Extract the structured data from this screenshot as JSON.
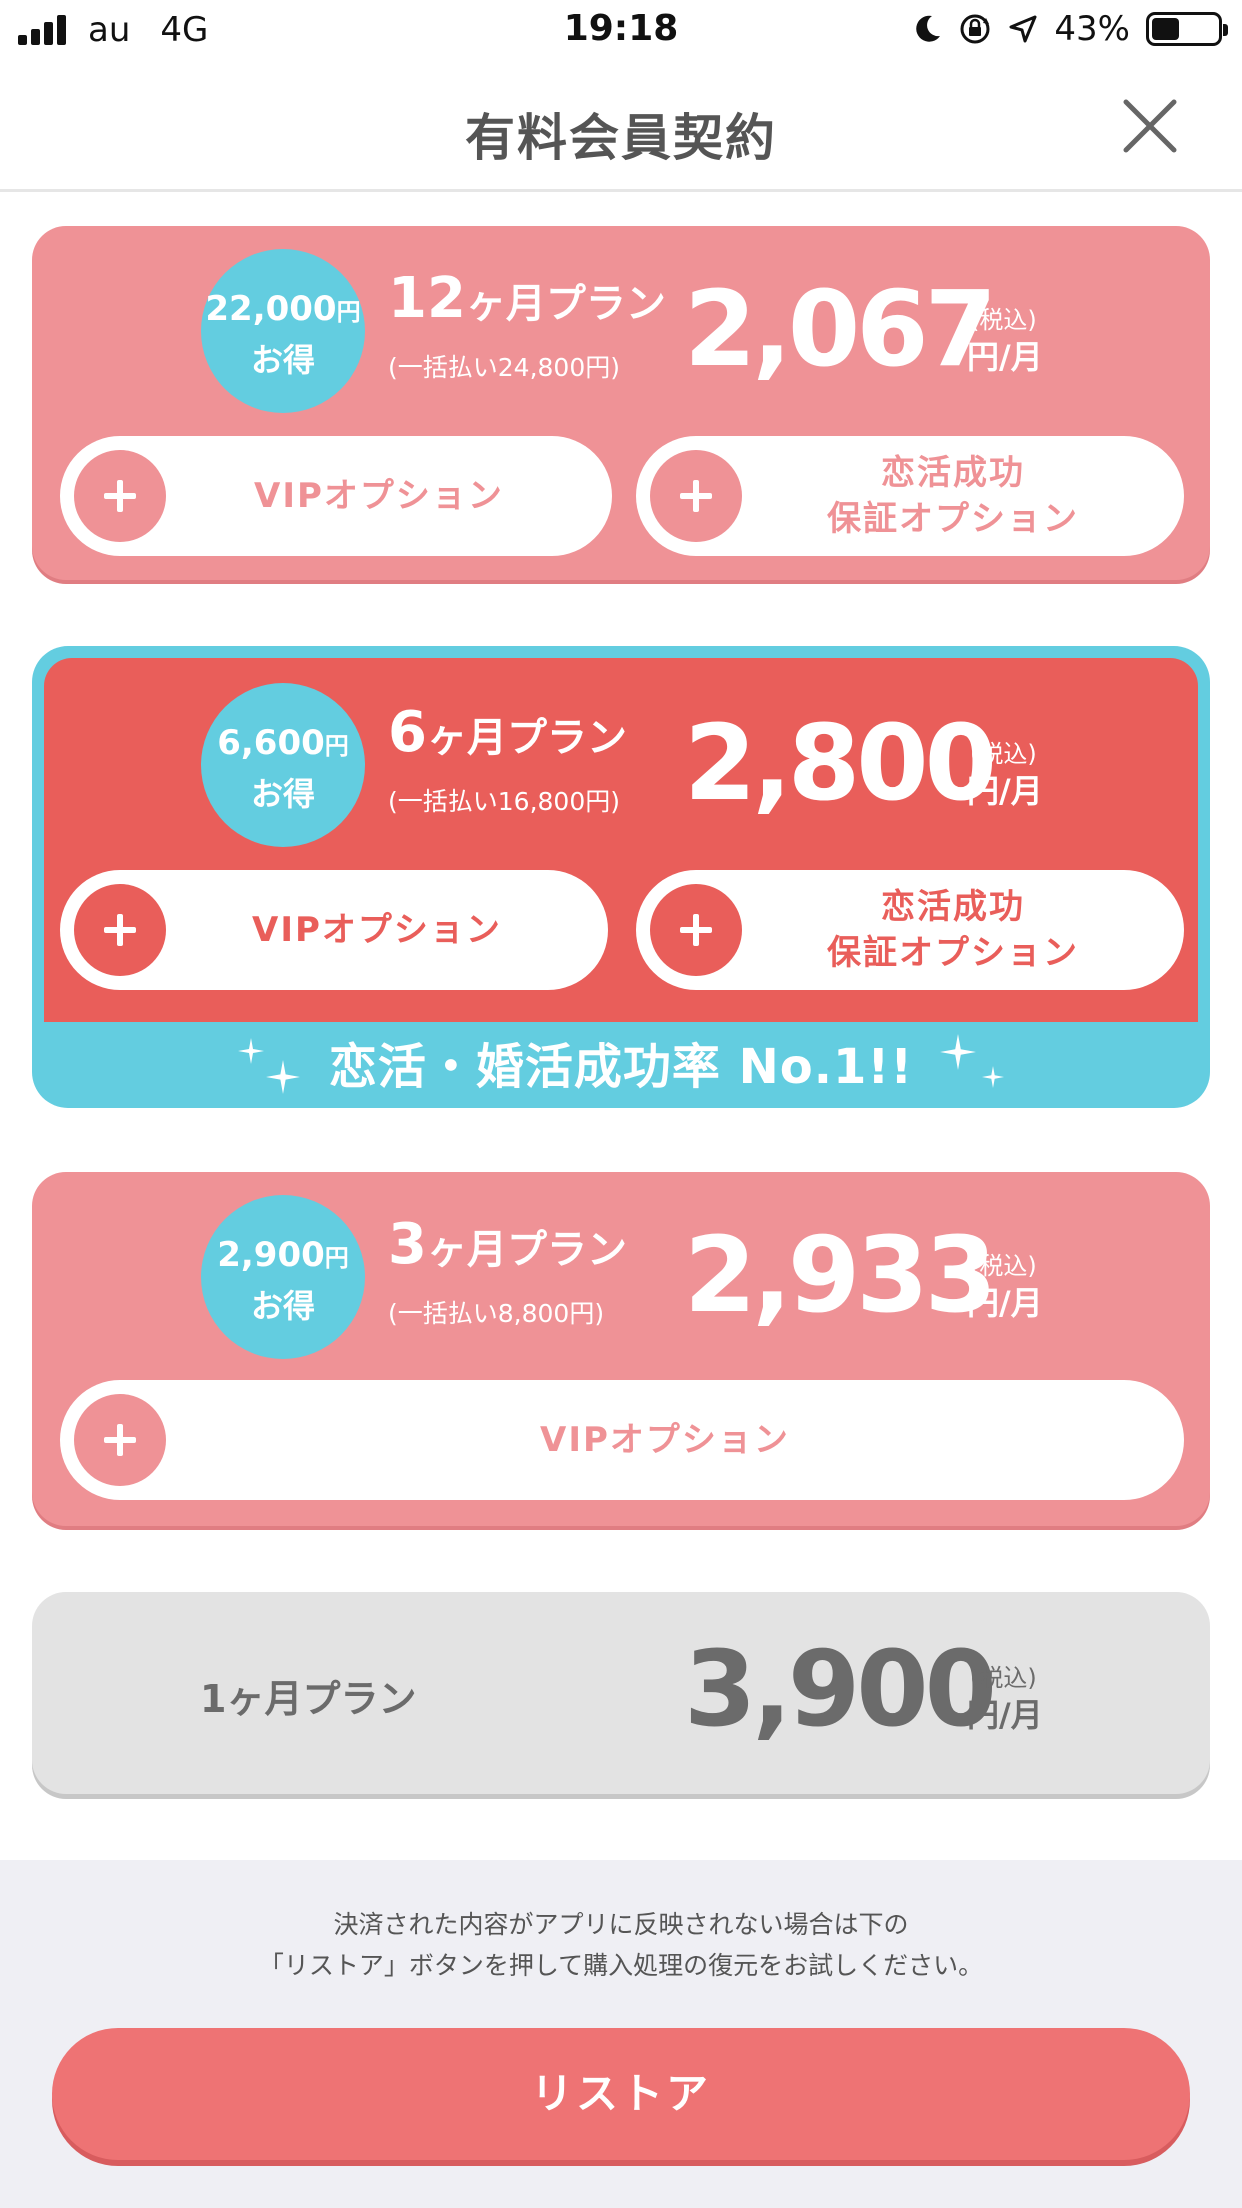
{
  "status_bar": {
    "carrier": "au",
    "network": "4G",
    "time": "19:18",
    "battery": "43%",
    "battery_level": 0.43,
    "icons": [
      "signal-icon",
      "moon-icon",
      "orientation-lock-icon",
      "location-arrow-icon",
      "battery-icon"
    ]
  },
  "header": {
    "title": "有料会員契約",
    "close_icon": "close-icon"
  },
  "plans": [
    {
      "badge_amount": "22,000",
      "badge_yen": "円",
      "badge_label": "お得",
      "months": "12",
      "plan_suffix": "ヶ月プラン",
      "lump_sum": "(一括払い24,800円)",
      "price": "2,067",
      "tax": "(税込)",
      "per": "円/月",
      "options": [
        "VIPオプション",
        "恋活成功\n保証オプション"
      ]
    },
    {
      "badge_amount": "6,600",
      "badge_yen": "円",
      "badge_label": "お得",
      "months": "6",
      "plan_suffix": "ヶ月プラン",
      "lump_sum": "(一括払い16,800円)",
      "price": "2,800",
      "tax": "(税込)",
      "per": "円/月",
      "options": [
        "VIPオプション",
        "恋活成功\n保証オプション"
      ],
      "banner": "恋活・婚活成功率 No.1!!"
    },
    {
      "badge_amount": "2,900",
      "badge_yen": "円",
      "badge_label": "お得",
      "months": "3",
      "plan_suffix": "ヶ月プラン",
      "lump_sum": "(一括払い8,800円)",
      "price": "2,933",
      "tax": "(税込)",
      "per": "円/月",
      "options": [
        "VIPオプション"
      ]
    },
    {
      "plan_name": "1ヶ月プラン",
      "price": "3,900",
      "tax": "(税込)",
      "per": "円/月"
    }
  ],
  "footer": {
    "notice_line1": "決済された内容がアプリに反映されない場合は下の",
    "notice_line2": "「リストア」ボタンを押して購入処理の復元をお試しください。",
    "restore_label": "リストア"
  },
  "colors": {
    "pink": "#ef9296",
    "red": "#e95e5a",
    "cyan": "#63cde0",
    "gray_card": "#e3e3e3",
    "restore": "#ee7374"
  }
}
